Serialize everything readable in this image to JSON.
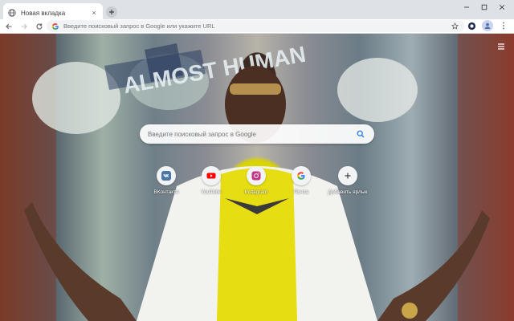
{
  "tab": {
    "title": "Новая вкладка",
    "close_glyph": "×",
    "favicon": "globe-icon"
  },
  "newtab": {
    "glyph": "+"
  },
  "window": {
    "minimize": "−",
    "maximize": "□",
    "close": "×"
  },
  "toolbar": {
    "back": "back-arrow-icon",
    "forward": "forward-arrow-icon",
    "reload": "reload-icon",
    "omnibox_placeholder": "Введите поисковый запрос в Google или укажите URL",
    "star": "star-icon",
    "extension": "extension-icon",
    "profile": "profile-avatar",
    "menu": "kebab-menu-icon"
  },
  "page": {
    "search_placeholder": "Введите поисковый запрос в Google",
    "shortcuts": [
      {
        "label": "ВКонтакте",
        "icon": "vk-icon",
        "color": "#4a76a8"
      },
      {
        "label": "YouTube",
        "icon": "youtube-icon",
        "color": "#ff0000"
      },
      {
        "label": "Instagram",
        "icon": "instagram-icon",
        "color": "#c13584"
      },
      {
        "label": "Почта",
        "icon": "google-icon",
        "color": "#4285f4"
      },
      {
        "label": "Добавить ярлык",
        "icon": "plus-icon",
        "color": "#3c4043"
      }
    ],
    "mural_text": "ALMOST HUMAN"
  },
  "colors": {
    "tabstrip": "#dee1e6",
    "toolbar": "#ffffff",
    "omnibox": "#f1f3f4",
    "accent": "#1a73e8"
  }
}
